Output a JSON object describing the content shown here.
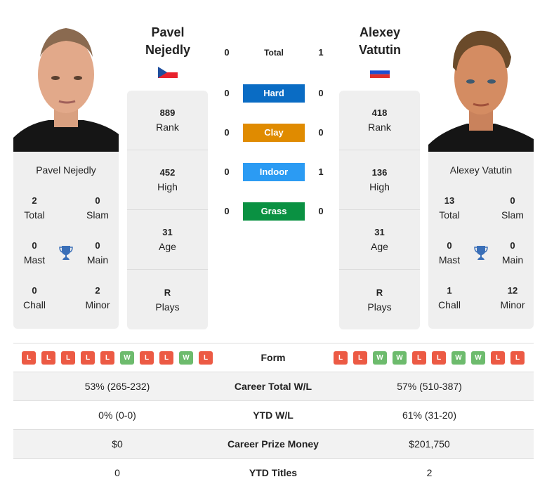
{
  "player_left": {
    "name_line1": "Pavel",
    "name_line2": "Nejedly",
    "full_name": "Pavel Nejedly",
    "country": "Czech Republic",
    "flag_icon": "flag-czech-republic",
    "stats": [
      {
        "value": "889",
        "label": "Rank"
      },
      {
        "value": "452",
        "label": "High"
      },
      {
        "value": "31",
        "label": "Age"
      },
      {
        "value": "R",
        "label": "Plays"
      }
    ],
    "titles": {
      "total": {
        "value": "2",
        "label": "Total"
      },
      "slam": {
        "value": "0",
        "label": "Slam"
      },
      "mast": {
        "value": "0",
        "label": "Mast"
      },
      "main": {
        "value": "0",
        "label": "Main"
      },
      "chall": {
        "value": "0",
        "label": "Chall"
      },
      "minor": {
        "value": "2",
        "label": "Minor"
      }
    },
    "form": [
      "L",
      "L",
      "L",
      "L",
      "L",
      "W",
      "L",
      "L",
      "W",
      "L"
    ]
  },
  "player_right": {
    "name_line1": "Alexey",
    "name_line2": "Vatutin",
    "full_name": "Alexey Vatutin",
    "country": "Russia",
    "flag_icon": "flag-russia",
    "stats": [
      {
        "value": "418",
        "label": "Rank"
      },
      {
        "value": "136",
        "label": "High"
      },
      {
        "value": "31",
        "label": "Age"
      },
      {
        "value": "R",
        "label": "Plays"
      }
    ],
    "titles": {
      "total": {
        "value": "13",
        "label": "Total"
      },
      "slam": {
        "value": "0",
        "label": "Slam"
      },
      "mast": {
        "value": "0",
        "label": "Mast"
      },
      "main": {
        "value": "0",
        "label": "Main"
      },
      "chall": {
        "value": "1",
        "label": "Chall"
      },
      "minor": {
        "value": "12",
        "label": "Minor"
      }
    },
    "form": [
      "L",
      "L",
      "W",
      "W",
      "L",
      "L",
      "W",
      "W",
      "L",
      "L"
    ]
  },
  "h2h": [
    {
      "label": "Total",
      "left": "0",
      "right": "1",
      "color": ""
    },
    {
      "label": "Hard",
      "left": "0",
      "right": "0",
      "color": "#0a6cc4"
    },
    {
      "label": "Clay",
      "left": "0",
      "right": "0",
      "color": "#e08b00"
    },
    {
      "label": "Indoor",
      "left": "0",
      "right": "1",
      "color": "#2b9bf3"
    },
    {
      "label": "Grass",
      "left": "0",
      "right": "0",
      "color": "#0a9142"
    }
  ],
  "form_label": "Form",
  "comparison": [
    {
      "label": "Career Total W/L",
      "left": "53% (265-232)",
      "right": "57% (510-387)"
    },
    {
      "label": "YTD W/L",
      "left": "0% (0-0)",
      "right": "61% (31-20)"
    },
    {
      "label": "Career Prize Money",
      "left": "$0",
      "right": "$201,750"
    },
    {
      "label": "YTD Titles",
      "left": "0",
      "right": "2"
    }
  ]
}
